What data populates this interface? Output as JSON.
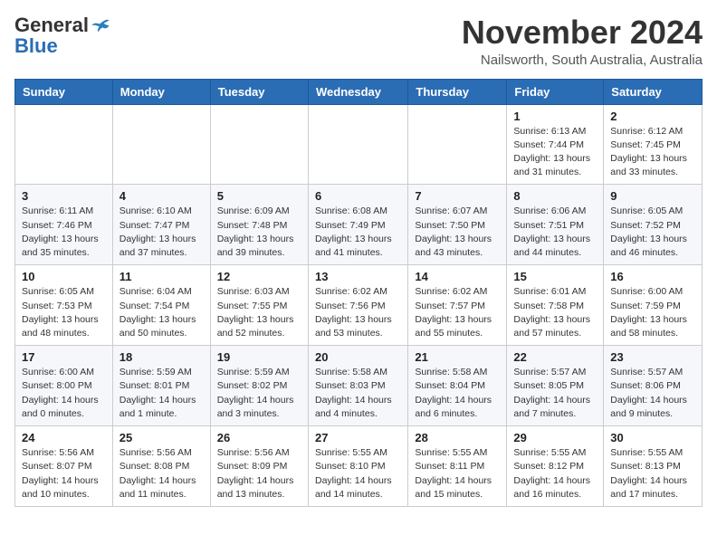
{
  "header": {
    "logo_line1": "General",
    "logo_line2": "Blue",
    "month": "November 2024",
    "location": "Nailsworth, South Australia, Australia"
  },
  "days_of_week": [
    "Sunday",
    "Monday",
    "Tuesday",
    "Wednesday",
    "Thursday",
    "Friday",
    "Saturday"
  ],
  "weeks": [
    [
      {
        "day": "",
        "info": ""
      },
      {
        "day": "",
        "info": ""
      },
      {
        "day": "",
        "info": ""
      },
      {
        "day": "",
        "info": ""
      },
      {
        "day": "",
        "info": ""
      },
      {
        "day": "1",
        "info": "Sunrise: 6:13 AM\nSunset: 7:44 PM\nDaylight: 13 hours\nand 31 minutes."
      },
      {
        "day": "2",
        "info": "Sunrise: 6:12 AM\nSunset: 7:45 PM\nDaylight: 13 hours\nand 33 minutes."
      }
    ],
    [
      {
        "day": "3",
        "info": "Sunrise: 6:11 AM\nSunset: 7:46 PM\nDaylight: 13 hours\nand 35 minutes."
      },
      {
        "day": "4",
        "info": "Sunrise: 6:10 AM\nSunset: 7:47 PM\nDaylight: 13 hours\nand 37 minutes."
      },
      {
        "day": "5",
        "info": "Sunrise: 6:09 AM\nSunset: 7:48 PM\nDaylight: 13 hours\nand 39 minutes."
      },
      {
        "day": "6",
        "info": "Sunrise: 6:08 AM\nSunset: 7:49 PM\nDaylight: 13 hours\nand 41 minutes."
      },
      {
        "day": "7",
        "info": "Sunrise: 6:07 AM\nSunset: 7:50 PM\nDaylight: 13 hours\nand 43 minutes."
      },
      {
        "day": "8",
        "info": "Sunrise: 6:06 AM\nSunset: 7:51 PM\nDaylight: 13 hours\nand 44 minutes."
      },
      {
        "day": "9",
        "info": "Sunrise: 6:05 AM\nSunset: 7:52 PM\nDaylight: 13 hours\nand 46 minutes."
      }
    ],
    [
      {
        "day": "10",
        "info": "Sunrise: 6:05 AM\nSunset: 7:53 PM\nDaylight: 13 hours\nand 48 minutes."
      },
      {
        "day": "11",
        "info": "Sunrise: 6:04 AM\nSunset: 7:54 PM\nDaylight: 13 hours\nand 50 minutes."
      },
      {
        "day": "12",
        "info": "Sunrise: 6:03 AM\nSunset: 7:55 PM\nDaylight: 13 hours\nand 52 minutes."
      },
      {
        "day": "13",
        "info": "Sunrise: 6:02 AM\nSunset: 7:56 PM\nDaylight: 13 hours\nand 53 minutes."
      },
      {
        "day": "14",
        "info": "Sunrise: 6:02 AM\nSunset: 7:57 PM\nDaylight: 13 hours\nand 55 minutes."
      },
      {
        "day": "15",
        "info": "Sunrise: 6:01 AM\nSunset: 7:58 PM\nDaylight: 13 hours\nand 57 minutes."
      },
      {
        "day": "16",
        "info": "Sunrise: 6:00 AM\nSunset: 7:59 PM\nDaylight: 13 hours\nand 58 minutes."
      }
    ],
    [
      {
        "day": "17",
        "info": "Sunrise: 6:00 AM\nSunset: 8:00 PM\nDaylight: 14 hours\nand 0 minutes."
      },
      {
        "day": "18",
        "info": "Sunrise: 5:59 AM\nSunset: 8:01 PM\nDaylight: 14 hours\nand 1 minute."
      },
      {
        "day": "19",
        "info": "Sunrise: 5:59 AM\nSunset: 8:02 PM\nDaylight: 14 hours\nand 3 minutes."
      },
      {
        "day": "20",
        "info": "Sunrise: 5:58 AM\nSunset: 8:03 PM\nDaylight: 14 hours\nand 4 minutes."
      },
      {
        "day": "21",
        "info": "Sunrise: 5:58 AM\nSunset: 8:04 PM\nDaylight: 14 hours\nand 6 minutes."
      },
      {
        "day": "22",
        "info": "Sunrise: 5:57 AM\nSunset: 8:05 PM\nDaylight: 14 hours\nand 7 minutes."
      },
      {
        "day": "23",
        "info": "Sunrise: 5:57 AM\nSunset: 8:06 PM\nDaylight: 14 hours\nand 9 minutes."
      }
    ],
    [
      {
        "day": "24",
        "info": "Sunrise: 5:56 AM\nSunset: 8:07 PM\nDaylight: 14 hours\nand 10 minutes."
      },
      {
        "day": "25",
        "info": "Sunrise: 5:56 AM\nSunset: 8:08 PM\nDaylight: 14 hours\nand 11 minutes."
      },
      {
        "day": "26",
        "info": "Sunrise: 5:56 AM\nSunset: 8:09 PM\nDaylight: 14 hours\nand 13 minutes."
      },
      {
        "day": "27",
        "info": "Sunrise: 5:55 AM\nSunset: 8:10 PM\nDaylight: 14 hours\nand 14 minutes."
      },
      {
        "day": "28",
        "info": "Sunrise: 5:55 AM\nSunset: 8:11 PM\nDaylight: 14 hours\nand 15 minutes."
      },
      {
        "day": "29",
        "info": "Sunrise: 5:55 AM\nSunset: 8:12 PM\nDaylight: 14 hours\nand 16 minutes."
      },
      {
        "day": "30",
        "info": "Sunrise: 5:55 AM\nSunset: 8:13 PM\nDaylight: 14 hours\nand 17 minutes."
      }
    ]
  ]
}
